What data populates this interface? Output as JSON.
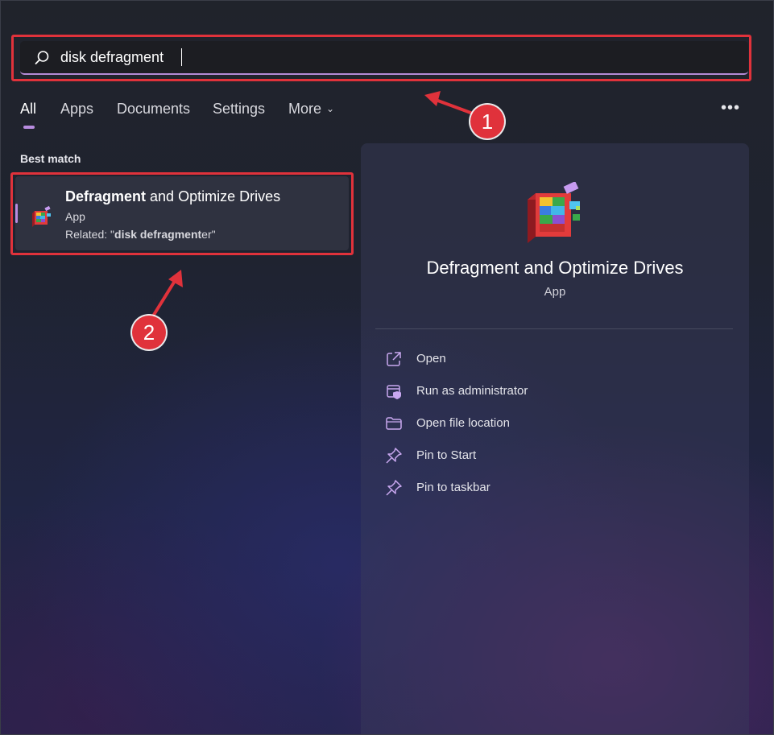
{
  "search": {
    "value": "disk defragment",
    "placeholder": ""
  },
  "tabs": [
    {
      "label": "All",
      "active": true
    },
    {
      "label": "Apps"
    },
    {
      "label": "Documents"
    },
    {
      "label": "Settings"
    },
    {
      "label": "More"
    }
  ],
  "more_options_label": "•••",
  "section_label": "Best match",
  "best_match": {
    "title_bold": "Defragment",
    "title_rest": " and Optimize Drives",
    "type": "App",
    "related_prefix": "Related: \"",
    "related_bold": "disk defragment",
    "related_rest": "er\""
  },
  "detail": {
    "title": "Defragment and Optimize Drives",
    "type": "App",
    "actions": [
      {
        "label": "Open",
        "icon": "open-external-icon"
      },
      {
        "label": "Run as administrator",
        "icon": "shield-window-icon"
      },
      {
        "label": "Open file location",
        "icon": "folder-icon"
      },
      {
        "label": "Pin to Start",
        "icon": "pin-icon"
      },
      {
        "label": "Pin to taskbar",
        "icon": "pin-icon"
      }
    ]
  },
  "annotations": [
    {
      "number": "1"
    },
    {
      "number": "2"
    }
  ],
  "colors": {
    "accent": "#b88ce0",
    "callout": "#e0323b"
  }
}
